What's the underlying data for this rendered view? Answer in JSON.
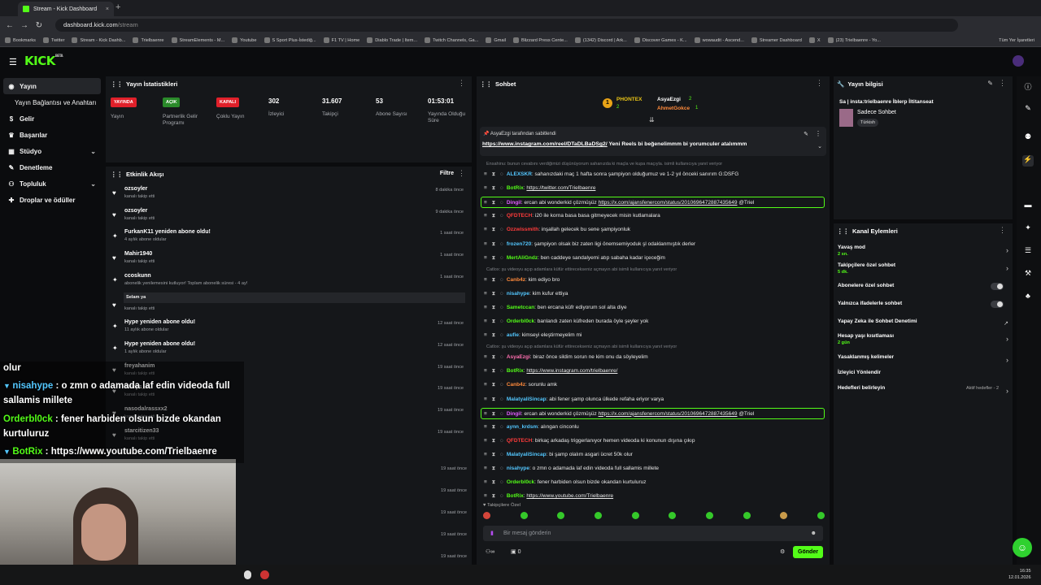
{
  "browser": {
    "tab_title": "Stream - Kick Dashboard",
    "url_host": "dashboard.kick.com",
    "url_path": "/stream",
    "bookmarks": [
      "Bookmarks",
      "Twitter",
      "Stream - Kick Dashb...",
      "Trielbaenre",
      "StreamElements - M...",
      "Youtube",
      "S Sport Plus-İstediğ...",
      "F1 TV | Home",
      "Diablo Trade | Item...",
      "Twitch Channels, Ga...",
      "Gmail",
      "Blizzard Press Cente...",
      "(1342) Discord | Ark...",
      "Discover Games - K...",
      "wowaudit - Ascend...",
      "Streamer Dashboard",
      "X",
      "(23) Trielbaenre - Yo..."
    ],
    "all_bookmarks": "Tüm Yer İşaretleri"
  },
  "sidebar": {
    "items": [
      {
        "label": "Yayın",
        "icon": "broadcast-icon"
      },
      {
        "label": "Yayın Bağlantısı ve Anahtarı",
        "icon": ""
      },
      {
        "label": "Gelir",
        "icon": "money-icon"
      },
      {
        "label": "Başarılar",
        "icon": "trophy-icon"
      },
      {
        "label": "Stüdyo",
        "icon": "studio-icon"
      },
      {
        "label": "Denetleme",
        "icon": "wrench-icon"
      },
      {
        "label": "Topluluk",
        "icon": "people-icon"
      },
      {
        "label": "Droplar ve ödüller",
        "icon": "gift-icon"
      }
    ]
  },
  "stats": {
    "title": "Yayın İstatistikleri",
    "items": [
      {
        "badge": "YAYINDA",
        "badge_color": "#e0202a",
        "label": "Yayın"
      },
      {
        "badge": "AÇIK",
        "badge_color": "#2a8a2a",
        "label": "Partnerlik Gelir Programı"
      },
      {
        "badge": "KAPALI",
        "badge_color": "#e0202a",
        "label": "Çoklu Yayın"
      },
      {
        "value": "302",
        "label": "İzleyici"
      },
      {
        "value": "31.607",
        "label": "Takipçi"
      },
      {
        "value": "53",
        "label": "Abone Sayısı"
      },
      {
        "value": "01:53:01",
        "label": "Yayında Olduğu Süre"
      }
    ]
  },
  "activity": {
    "title": "Etkinlik Akışı",
    "filter": "Filtre",
    "items": [
      {
        "icon": "heart",
        "name": "ozsoyler",
        "desc": "kanalı takip etti",
        "time": "8 dakika önce"
      },
      {
        "icon": "heart",
        "name": "ozsoyler",
        "desc": "kanalı takip etti",
        "time": "9 dakika önce"
      },
      {
        "icon": "star",
        "name": "FurkanK11 yeniden abone oldu!",
        "desc": "4 aylık abone oldular",
        "time": "1 saat önce"
      },
      {
        "icon": "heart",
        "name": "Mahir1940",
        "desc": "kanalı takip etti",
        "time": "1 saat önce"
      },
      {
        "icon": "star",
        "name": "ccoskunn",
        "desc": "abonelik yenilemesini kutluyor! Toplam abonelik süresi - 4 ay!",
        "time": "1 saat önce"
      },
      {
        "icon": "heart",
        "name": "Netisfc",
        "desc": "kanalı takip etti",
        "time": "1 saat önce"
      },
      {
        "icon": "star",
        "name": "Hype yeniden abone oldu!",
        "desc": "11 aylık abone oldular",
        "time": "12 saat önce"
      },
      {
        "icon": "star",
        "name": "Hype yeniden abone oldu!",
        "desc": "1 aylık abone oldular",
        "time": "12 saat önce"
      },
      {
        "icon": "heart",
        "name": "freyahanim",
        "desc": "kanalı takip etti",
        "time": "19 saat önce"
      },
      {
        "icon": "heart",
        "name": "Emrys_X",
        "desc": "kanalı takip etti",
        "time": "19 saat önce"
      },
      {
        "icon": "heart",
        "name": "nasodalrassxx2",
        "desc": "kanalı takip etti",
        "time": "19 saat önce"
      },
      {
        "icon": "heart",
        "name": "starcitizen33",
        "desc": "kanalı takip etti",
        "time": "19 saat önce"
      }
    ],
    "more_times": [
      "19 saat önce",
      "19 saat önce",
      "19 saat önce",
      "19 saat önce",
      "19 saat önce"
    ],
    "resub_message": "Selam ya"
  },
  "chat": {
    "title": "Sohbet",
    "top": [
      {
        "name": "PHONTEX",
        "count": "2",
        "rank": "1"
      },
      {
        "name": "AsyaEzgi",
        "count": "2"
      },
      {
        "name": "AhmetGokce",
        "count": "1"
      }
    ],
    "pinned_by": "AsyaEzgi tarafından sabitlendi",
    "pinned_link": "https://www.instagram.com/reel/DTaDLBaDSg2/",
    "pinned_text": " Yeni Reels bi beğenelimmm bi yorumculer atalımmm",
    "messages": [
      {
        "reply": "Ensahinu: bunun cevabını verdiğimizi düşünüyorum sahanızda ki maçla ve kupa maçıyla. isimli kullanıcıya yanıt veriyor"
      },
      {
        "user": "ALEXSKR",
        "color": "#53c7ff",
        "text": "sahanızdaki maç 1 hafta sonra şampiyon olduğumuz ve 1-2 yıl önceki sanırım G:DSFG"
      },
      {
        "user": "BotRix",
        "color": "#53fc18",
        "link": "https://twitter.com/Trielbaenre"
      },
      {
        "user": "Dingil",
        "color": "#e05cff",
        "text": "ercan abi wonderkid çözmüşüz ",
        "link": "https://x.com/ajansfenercom/status/2010696472887435649",
        "after": " @Triel",
        "hl": true
      },
      {
        "user": "QFDTECH",
        "color": "#ff3b3b",
        "text": "i20 ile korna basa basa gitmeyecek misin kutlamalara"
      },
      {
        "user": "Ozzwissmith",
        "color": "#ff3b3b",
        "text": "inşallah gelecek bu sene şampiyonluk"
      },
      {
        "user": "frozen720",
        "color": "#53c7ff",
        "text": "şampiyon olsak biz zaten ligi önemsemiyoduk şl odaklanmıştık derler"
      },
      {
        "user": "MertAliGndz",
        "color": "#53fc18",
        "text": "ben caddeye sandalyemi atıp sabaha kadar içeceğim"
      },
      {
        "reply": "Catlox: şu videoyu açıp adamlara küfür ettirecekseniz açmayın abi isimli kullanıcıya yanıt veriyor"
      },
      {
        "user": "Canb4z",
        "color": "#ff8a3b",
        "text": "kim ediyo bro"
      },
      {
        "user": "nisahype",
        "color": "#53c7ff",
        "text": "kim kufur ettiya"
      },
      {
        "user": "Sametccan",
        "color": "#53fc18",
        "text": "ben ercana küfr ediyorum sol alta diye"
      },
      {
        "user": "Orderbl0ck",
        "color": "#53fc18",
        "text": "banlandı zaten küfreden burada öyle şeyler yok"
      },
      {
        "user": "aufie",
        "color": "#53c7ff",
        "text": "kimseyi eleştirmeyelim mi"
      },
      {
        "reply": "Catlox: şu videoyu açıp adamlara küfür ettirecekseniz açmayın abi isimli kullanıcıya yanıt veriyor"
      },
      {
        "user": "AsyaEzgi",
        "color": "#ff6fb0",
        "text": "biraz önce sildim sorun ne kim onu da söyleyelim"
      },
      {
        "user": "BotRix",
        "color": "#53fc18",
        "link": "https://www.instagram.com/trielbaenre/"
      },
      {
        "user": "Canb4z",
        "color": "#ff8a3b",
        "text": "sorunlu amk"
      },
      {
        "user": "MalatyaliSincap",
        "color": "#53c7ff",
        "text": "abi fener şamp olunca ülkede refaha eriyor varya"
      },
      {
        "user": "Dingil",
        "color": "#e05cff",
        "text": "ercan abi wonderkid çözmüşüz ",
        "link": "https://x.com/ajansfenercom/status/2010696472887435649",
        "after": " @Triel",
        "hl": true
      },
      {
        "user": "aynn_krdsm",
        "color": "#53c7ff",
        "text": "alıngan cinconlu"
      },
      {
        "user": "QFDTECH",
        "color": "#ff3b3b",
        "text": "birkaç arkadaş triggerlanıyor hemen videoda ki konunun dışına çıkıp"
      },
      {
        "user": "MalatyaliSincap",
        "color": "#53c7ff",
        "text": "bi şamp olalım asgari ücret 50k olur"
      },
      {
        "user": "nisahype",
        "color": "#53c7ff",
        "text": "o zmn o adamada laf edin videoda full sallamis millete"
      },
      {
        "user": "Orderbl0ck",
        "color": "#53fc18",
        "text": "fener harbiden olsun bizde okandan kurtuluruz"
      },
      {
        "user": "BotRix",
        "color": "#53fc18",
        "link": "https://www.youtube.com/Trielbaenre"
      }
    ],
    "mode": "Takipçilere Özel",
    "input_placeholder": "Bir mesaj gönderin",
    "points": "0",
    "send": "Gönder"
  },
  "info": {
    "title": "Yayın bilgisi",
    "stream_title": "Sa | insta:trielbaenre İblerp İltitanseat",
    "category": "Sadece Sohbet",
    "language": "Türkish"
  },
  "channel_actions": {
    "title": "Kanal Eylemleri",
    "items": [
      {
        "label": "Yavaş mod",
        "sub": "2 sn.",
        "kind": "arrow"
      },
      {
        "label": "Takipçilere özel sohbet",
        "sub": "5 dk.",
        "kind": "arrow"
      },
      {
        "label": "Abonelere özel sohbet",
        "kind": "toggle"
      },
      {
        "label": "Yalnızca ifadelerle sohbet",
        "kind": "toggle"
      },
      {
        "label": "Yapay Zeka ile Sohbet Denetimi",
        "kind": "ext"
      },
      {
        "label": "Hesap yaşı kısıtlaması",
        "sub": "2 gün",
        "kind": "arrow"
      },
      {
        "label": "Yasaklanmış kelimeler",
        "kind": "arrow"
      },
      {
        "label": "İzleyici Yönlendir",
        "kind": "none"
      },
      {
        "label": "Hedefleri belirleyin",
        "kind": "arrow",
        "right": "Aktif hedefler - 2"
      }
    ]
  },
  "overlay": [
    {
      "user": "olur",
      "text": ""
    },
    {
      "user": "nisahype",
      "text": " : o zmn o adamada laf edin videoda full sallamis millete",
      "color": "#53c7ff"
    },
    {
      "user": "Orderbl0ck",
      "text": " : fener harbiden olsun bizde okandan kurtuluruz",
      "color": "#53fc18"
    },
    {
      "user": "BotRix",
      "text": " : https://www.youtube.com/Trielbaenre",
      "color": "#53fc18"
    }
  ],
  "clock": {
    "time": "16:35",
    "date": "12.01.2026"
  }
}
